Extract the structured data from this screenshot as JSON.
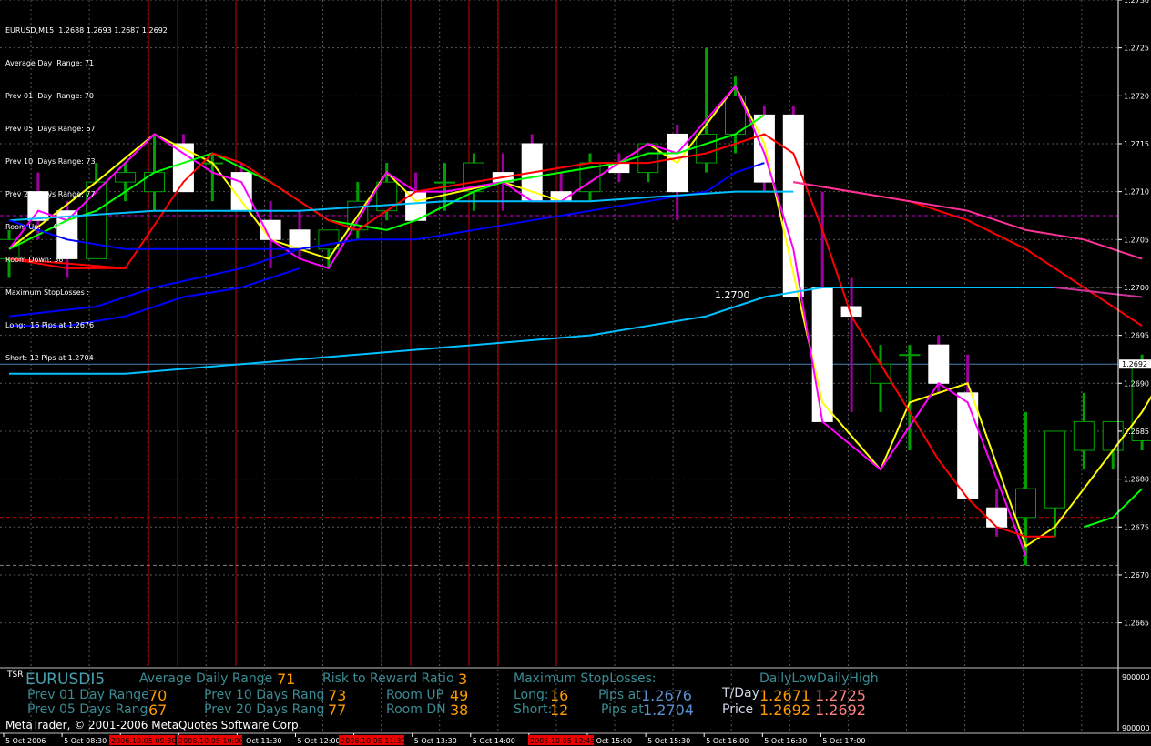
{
  "chart_data": {
    "type": "candlestick",
    "symbol_header": "EURUSD,M15  1.2688 1.2693 1.2687 1.2692",
    "ylim": [
      1.266,
      1.273
    ],
    "price_ticks": [
      "1.2730",
      "1.2725",
      "1.2720",
      "1.2715",
      "1.2710",
      "1.2705",
      "1.2700",
      "1.2695",
      "1.2690",
      "1.2685",
      "1.2680",
      "1.2675",
      "1.2670",
      "1.2665"
    ],
    "current_price_label": "1.2692",
    "current_price": 1.2692,
    "level_label": "1.2700",
    "level_label_price": 1.27,
    "x_ticks": [
      "5 Oct 2006",
      "5 Oct 08:30",
      "5 Oct 09:30",
      "5 Oct 10:30",
      "5 Oct 11:30",
      "5 Oct 12:00",
      "5 Oct 13:00",
      "5 Oct 13:30",
      "5 Oct 14:00",
      "5 Oct 14:30",
      "5 Oct 15:00",
      "5 Oct 15:30",
      "5 Oct 16:00",
      "5 Oct 16:30",
      "5 Oct 17:00"
    ],
    "highlighted_time_labels": [
      "2006.10.05 09:30",
      "2006.10.05 10:00",
      "2006.10.05 11:30",
      "2006.10.05 12:45"
    ],
    "candles": [
      {
        "o": 1.2703,
        "h": 1.2706,
        "l": 1.2701,
        "c": 1.2705
      },
      {
        "o": 1.271,
        "h": 1.2712,
        "l": 1.2705,
        "c": 1.2707
      },
      {
        "o": 1.2708,
        "h": 1.2709,
        "l": 1.2701,
        "c": 1.2703
      },
      {
        "o": 1.2703,
        "h": 1.2713,
        "l": 1.2703,
        "c": 1.2711
      },
      {
        "o": 1.2711,
        "h": 1.2713,
        "l": 1.2709,
        "c": 1.2712
      },
      {
        "o": 1.271,
        "h": 1.2716,
        "l": 1.2708,
        "c": 1.2712
      },
      {
        "o": 1.2715,
        "h": 1.2716,
        "l": 1.271,
        "c": 1.271
      },
      {
        "o": 1.2713,
        "h": 1.2714,
        "l": 1.2709,
        "c": 1.2713
      },
      {
        "o": 1.2712,
        "h": 1.2713,
        "l": 1.2708,
        "c": 1.2708
      },
      {
        "o": 1.2707,
        "h": 1.2709,
        "l": 1.2702,
        "c": 1.2705
      },
      {
        "o": 1.2706,
        "h": 1.2708,
        "l": 1.2703,
        "c": 1.2704
      },
      {
        "o": 1.2704,
        "h": 1.2706,
        "l": 1.2702,
        "c": 1.2706
      },
      {
        "o": 1.2706,
        "h": 1.2711,
        "l": 1.2705,
        "c": 1.2709
      },
      {
        "o": 1.2708,
        "h": 1.2713,
        "l": 1.2707,
        "c": 1.2711
      },
      {
        "o": 1.271,
        "h": 1.2712,
        "l": 1.2707,
        "c": 1.2707
      },
      {
        "o": 1.2711,
        "h": 1.2713,
        "l": 1.2708,
        "c": 1.2711
      },
      {
        "o": 1.271,
        "h": 1.2714,
        "l": 1.2708,
        "c": 1.2713
      },
      {
        "o": 1.2712,
        "h": 1.2714,
        "l": 1.2708,
        "c": 1.2711
      },
      {
        "o": 1.2715,
        "h": 1.2716,
        "l": 1.2709,
        "c": 1.2709
      },
      {
        "o": 1.271,
        "h": 1.2712,
        "l": 1.2709,
        "c": 1.2709
      },
      {
        "o": 1.271,
        "h": 1.2714,
        "l": 1.2709,
        "c": 1.2713
      },
      {
        "o": 1.2713,
        "h": 1.2714,
        "l": 1.2711,
        "c": 1.2712
      },
      {
        "o": 1.2712,
        "h": 1.2715,
        "l": 1.2711,
        "c": 1.2715
      },
      {
        "o": 1.2716,
        "h": 1.2717,
        "l": 1.2707,
        "c": 1.271
      },
      {
        "o": 1.2713,
        "h": 1.2725,
        "l": 1.2712,
        "c": 1.2716
      },
      {
        "o": 1.2716,
        "h": 1.2722,
        "l": 1.2714,
        "c": 1.272
      },
      {
        "o": 1.2718,
        "h": 1.2719,
        "l": 1.271,
        "c": 1.2711
      },
      {
        "o": 1.2718,
        "h": 1.2719,
        "l": 1.2699,
        "c": 1.2699
      },
      {
        "o": 1.27,
        "h": 1.271,
        "l": 1.2689,
        "c": 1.2686
      },
      {
        "o": 1.2698,
        "h": 1.2701,
        "l": 1.2687,
        "c": 1.2697
      },
      {
        "o": 1.269,
        "h": 1.2694,
        "l": 1.2687,
        "c": 1.2692
      },
      {
        "o": 1.2693,
        "h": 1.2694,
        "l": 1.2683,
        "c": 1.2693
      },
      {
        "o": 1.2694,
        "h": 1.2695,
        "l": 1.2689,
        "c": 1.269
      },
      {
        "o": 1.2689,
        "h": 1.2693,
        "l": 1.2679,
        "c": 1.2678
      },
      {
        "o": 1.2677,
        "h": 1.2679,
        "l": 1.2674,
        "c": 1.2675
      },
      {
        "o": 1.2676,
        "h": 1.2687,
        "l": 1.2671,
        "c": 1.2679
      },
      {
        "o": 1.2677,
        "h": 1.2685,
        "l": 1.2674,
        "c": 1.2685
      },
      {
        "o": 1.2683,
        "h": 1.2689,
        "l": 1.2681,
        "c": 1.2686
      },
      {
        "o": 1.2683,
        "h": 1.2686,
        "l": 1.2681,
        "c": 1.2686
      },
      {
        "o": 1.2684,
        "h": 1.2693,
        "l": 1.2683,
        "c": 1.2692
      }
    ],
    "lines": [
      {
        "color": "#ffff00",
        "points": [
          [
            0,
            1.2704
          ],
          [
            3,
            1.2711
          ],
          [
            5,
            1.2716
          ],
          [
            7,
            1.2713
          ],
          [
            9,
            1.2705
          ],
          [
            11,
            1.2703
          ],
          [
            13,
            1.2712
          ],
          [
            14,
            1.2709
          ],
          [
            17,
            1.2711
          ],
          [
            19,
            1.2709
          ],
          [
            21,
            1.2713
          ],
          [
            22,
            1.2715
          ],
          [
            23,
            1.2713
          ],
          [
            25,
            1.2721
          ],
          [
            26,
            1.2715
          ],
          [
            28,
            1.2688
          ],
          [
            30,
            1.2681
          ],
          [
            31,
            1.2688
          ],
          [
            33,
            1.269
          ],
          [
            35,
            1.2673
          ],
          [
            36,
            1.2675
          ],
          [
            38,
            1.2683
          ],
          [
            39,
            1.2687
          ],
          [
            40,
            1.2692
          ]
        ]
      },
      {
        "color": "#ff00ff",
        "points": [
          [
            0,
            1.2704
          ],
          [
            1,
            1.2708
          ],
          [
            2,
            1.2707
          ],
          [
            5,
            1.2716
          ],
          [
            7,
            1.2712
          ],
          [
            8,
            1.2711
          ],
          [
            9,
            1.2705
          ],
          [
            10,
            1.2703
          ],
          [
            11,
            1.2702
          ],
          [
            13,
            1.2712
          ],
          [
            14,
            1.271
          ],
          [
            15,
            1.271
          ],
          [
            17,
            1.2711
          ],
          [
            18,
            1.2709
          ],
          [
            19,
            1.2709
          ],
          [
            21,
            1.2713
          ],
          [
            22,
            1.2715
          ],
          [
            23,
            1.2714
          ],
          [
            25,
            1.2721
          ],
          [
            26,
            1.2714
          ],
          [
            27,
            1.2704
          ],
          [
            28,
            1.2686
          ],
          [
            30,
            1.2681
          ],
          [
            32,
            1.269
          ],
          [
            33,
            1.2688
          ],
          [
            34,
            1.268
          ],
          [
            35,
            1.2672
          ]
        ]
      },
      {
        "color": "#00ff00",
        "points": [
          [
            0,
            1.2704
          ],
          [
            2,
            1.2707
          ],
          [
            3,
            1.2708
          ],
          [
            5,
            1.2712
          ],
          [
            7,
            1.2714
          ],
          [
            9,
            1.2711
          ],
          [
            11,
            1.2707
          ],
          [
            13,
            1.2706
          ],
          [
            14,
            1.2707
          ],
          [
            16,
            1.271
          ],
          [
            17,
            1.2711
          ],
          [
            19,
            1.2712
          ],
          [
            21,
            1.2713
          ],
          [
            22,
            1.2714
          ],
          [
            23,
            1.2714
          ],
          [
            25,
            1.2716
          ],
          [
            26,
            1.2718
          ]
        ]
      },
      {
        "color": "#00ff00",
        "points": [
          [
            37,
            1.2675
          ],
          [
            38,
            1.2676
          ],
          [
            39,
            1.2679
          ]
        ]
      },
      {
        "color": "#ff0000",
        "points": [
          [
            0,
            1.2703
          ],
          [
            2,
            1.2702
          ],
          [
            4,
            1.2702
          ],
          [
            6,
            1.2711
          ],
          [
            7,
            1.2714
          ],
          [
            8,
            1.2713
          ],
          [
            9,
            1.2711
          ],
          [
            11,
            1.2707
          ],
          [
            12,
            1.2706
          ],
          [
            14,
            1.271
          ],
          [
            16,
            1.2711
          ],
          [
            18,
            1.2712
          ],
          [
            20,
            1.2713
          ],
          [
            22,
            1.2713
          ],
          [
            24,
            1.2714
          ],
          [
            25,
            1.2715
          ],
          [
            26,
            1.2716
          ],
          [
            27,
            1.2714
          ],
          [
            28,
            1.2706
          ],
          [
            29,
            1.2697
          ],
          [
            30,
            1.2692
          ],
          [
            31,
            1.2687
          ],
          [
            32,
            1.2682
          ],
          [
            33,
            1.2678
          ],
          [
            34,
            1.2675
          ],
          [
            35,
            1.2674
          ],
          [
            36,
            1.2674
          ]
        ]
      },
      {
        "color": "#ff0000",
        "points": [
          [
            27,
            1.2711
          ],
          [
            29,
            1.271
          ],
          [
            31,
            1.2709
          ],
          [
            33,
            1.2707
          ],
          [
            35,
            1.2704
          ],
          [
            37,
            1.27
          ],
          [
            39,
            1.2696
          ]
        ]
      },
      {
        "color": "#ff3399",
        "points": [
          [
            27,
            1.2711
          ],
          [
            29,
            1.271
          ],
          [
            31,
            1.2709
          ],
          [
            33,
            1.2708
          ],
          [
            35,
            1.2706
          ],
          [
            37,
            1.2705
          ],
          [
            39,
            1.2703
          ]
        ]
      },
      {
        "color": "#0000ff",
        "points": [
          [
            0,
            1.2697
          ],
          [
            3,
            1.2698
          ],
          [
            5,
            1.27
          ],
          [
            8,
            1.2702
          ],
          [
            10,
            1.2704
          ],
          [
            12,
            1.2705
          ],
          [
            14,
            1.2705
          ],
          [
            16,
            1.2706
          ],
          [
            18,
            1.2707
          ],
          [
            20,
            1.2708
          ],
          [
            22,
            1.2709
          ],
          [
            24,
            1.271
          ],
          [
            25,
            1.2712
          ],
          [
            26,
            1.2713
          ]
        ]
      },
      {
        "color": "#0000ff",
        "points": [
          [
            0,
            1.2696
          ],
          [
            2,
            1.2696
          ],
          [
            4,
            1.2697
          ],
          [
            6,
            1.2699
          ],
          [
            8,
            1.27
          ],
          [
            10,
            1.2702
          ]
        ]
      },
      {
        "color": "#00bfff",
        "points": [
          [
            0,
            1.2707
          ],
          [
            5,
            1.2708
          ],
          [
            10,
            1.2708
          ],
          [
            15,
            1.2709
          ],
          [
            20,
            1.2709
          ],
          [
            25,
            1.271
          ],
          [
            27,
            1.271
          ]
        ]
      },
      {
        "color": "#00bfff",
        "points": [
          [
            0,
            1.2691
          ],
          [
            4,
            1.2691
          ],
          [
            8,
            1.2692
          ],
          [
            12,
            1.2693
          ],
          [
            16,
            1.2694
          ],
          [
            20,
            1.2695
          ],
          [
            24,
            1.2697
          ],
          [
            26,
            1.2699
          ],
          [
            28,
            1.27
          ],
          [
            30,
            1.27
          ],
          [
            34,
            1.27
          ],
          [
            36,
            1.27
          ]
        ]
      },
      {
        "color": "#cc3399",
        "points": [
          [
            36,
            1.27
          ],
          [
            39,
            1.2699
          ]
        ]
      },
      {
        "color": "#0000ff",
        "points": [
          [
            0,
            1.2707
          ],
          [
            2,
            1.2705
          ],
          [
            4,
            1.2704
          ],
          [
            6,
            1.2704
          ],
          [
            8,
            1.2704
          ],
          [
            10,
            1.2704
          ],
          [
            12,
            1.2705
          ]
        ]
      },
      {
        "color": "#ff0000",
        "points": [
          [
            0,
            1.2703
          ],
          [
            4,
            1.2702
          ]
        ]
      }
    ],
    "hlines": [
      {
        "price": 1.27158,
        "color": "#c0c0c0",
        "style": "dash"
      },
      {
        "price": 1.27075,
        "color": "#cc00cc",
        "style": "dash"
      },
      {
        "price": 1.27,
        "color": "#808080",
        "style": "dash"
      },
      {
        "price": 1.2692,
        "color": "#4682b4",
        "style": "solid"
      },
      {
        "price": 1.2676,
        "color": "#cc0000",
        "style": "dash"
      },
      {
        "price": 1.2671,
        "color": "#808080",
        "style": "dash"
      }
    ]
  },
  "info": {
    "lines": [
      "EURUSD,M15  1.2688 1.2693 1.2687 1.2692",
      "Average Day  Range: 71",
      "Prev 01  Day  Range: 70",
      "Prev 05  Days Range: 67",
      "Prev 10  Days Range: 73",
      "Prev 20  Days Range: 77",
      "Room Up:     49",
      "Room Down: 38",
      "Maximum StopLosses :",
      "Long:  16 Pips at 1.2676",
      "Short: 12 Pips at 1.2704"
    ]
  },
  "subwindow": {
    "label": "TSR",
    "scale_top": "900000",
    "scale_bottom": "900000",
    "symbol": "EURUSDI5",
    "avg_label": "Average Daily Range",
    "avg_val": "71",
    "p01_label": "Prev 01 Day Range",
    "p01_val": "70",
    "p05_label": "Prev 05 Days Rang",
    "p05_val": "67",
    "p10_label": "Prev 10 Days Rang",
    "p10_val": "73",
    "p20_label": "Prev 20 Days Rang",
    "p20_val": "77",
    "rr_label": "Risk to Reward Ratio",
    "rr_val": "3",
    "room_up_label": "Room UP",
    "room_up_val": "49",
    "room_dn_label": "Room DN",
    "room_dn_val": "38",
    "msl_label": "Maximum StopLosses:",
    "long_label": "Long:",
    "long_val": "16",
    "short_label": "Short:",
    "short_val": "12",
    "pips_at_label": "Pips at",
    "long_price": "1.2676",
    "short_price": "1.2704",
    "daily_hdr": "DailyLowDailyHigh",
    "tday_label": "T/Day",
    "tday_low": "1.2671",
    "tday_high": "1.2725",
    "price_label": "Price",
    "price_low": "1.2692",
    "price_high": "1.2692"
  },
  "copyright": "MetaTrader, © 2001-2006 MetaQuotes Software Corp.",
  "colors": {
    "bg": "#000000",
    "grid": "#5a5a5a",
    "bull": "#00aa00",
    "bear": "#ffffff",
    "vline": "#cc0000"
  }
}
